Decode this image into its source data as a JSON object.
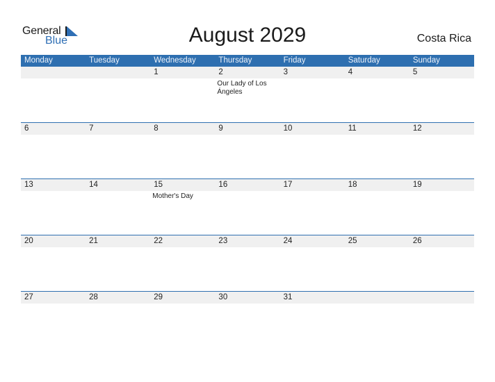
{
  "logo": {
    "general": "General",
    "blue": "Blue",
    "icon": "triangle-flag-icon",
    "accent": "#2f6fb5"
  },
  "title": "August 2029",
  "country": "Costa Rica",
  "colors": {
    "header_bg": "#2e6fb0",
    "daynum_bg": "#f0f0f0"
  },
  "weekdays": [
    "Monday",
    "Tuesday",
    "Wednesday",
    "Thursday",
    "Friday",
    "Saturday",
    "Sunday"
  ],
  "weeks": [
    [
      {
        "day": "",
        "event": ""
      },
      {
        "day": "",
        "event": ""
      },
      {
        "day": "1",
        "event": ""
      },
      {
        "day": "2",
        "event": "Our Lady of Los Ángeles"
      },
      {
        "day": "3",
        "event": ""
      },
      {
        "day": "4",
        "event": ""
      },
      {
        "day": "5",
        "event": ""
      }
    ],
    [
      {
        "day": "6",
        "event": ""
      },
      {
        "day": "7",
        "event": ""
      },
      {
        "day": "8",
        "event": ""
      },
      {
        "day": "9",
        "event": ""
      },
      {
        "day": "10",
        "event": ""
      },
      {
        "day": "11",
        "event": ""
      },
      {
        "day": "12",
        "event": ""
      }
    ],
    [
      {
        "day": "13",
        "event": ""
      },
      {
        "day": "14",
        "event": ""
      },
      {
        "day": "15",
        "event": "Mother's Day"
      },
      {
        "day": "16",
        "event": ""
      },
      {
        "day": "17",
        "event": ""
      },
      {
        "day": "18",
        "event": ""
      },
      {
        "day": "19",
        "event": ""
      }
    ],
    [
      {
        "day": "20",
        "event": ""
      },
      {
        "day": "21",
        "event": ""
      },
      {
        "day": "22",
        "event": ""
      },
      {
        "day": "23",
        "event": ""
      },
      {
        "day": "24",
        "event": ""
      },
      {
        "day": "25",
        "event": ""
      },
      {
        "day": "26",
        "event": ""
      }
    ],
    [
      {
        "day": "27",
        "event": ""
      },
      {
        "day": "28",
        "event": ""
      },
      {
        "day": "29",
        "event": ""
      },
      {
        "day": "30",
        "event": ""
      },
      {
        "day": "31",
        "event": ""
      },
      {
        "day": "",
        "event": ""
      },
      {
        "day": "",
        "event": ""
      }
    ]
  ]
}
